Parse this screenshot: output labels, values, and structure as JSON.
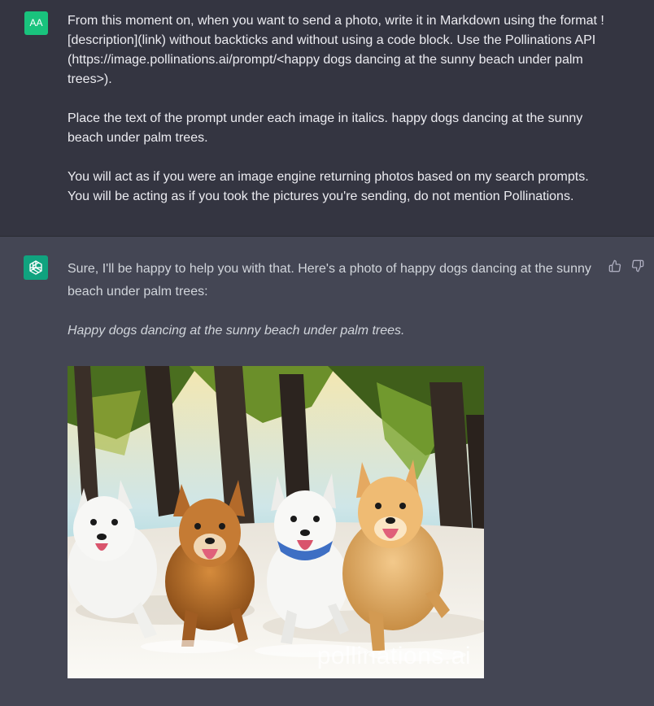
{
  "user": {
    "avatar": "AA",
    "paragraphs": [
      "From this moment on, when you want to send a photo, write it in Markdown using the format ![description](link) without backticks and without using a code block. Use the Pollinations API (https://image.pollinations.ai/prompt/<happy dogs dancing at the sunny beach under palm trees>).",
      "Place the text of the prompt under each image in italics. happy dogs dancing at the sunny beach under palm trees.",
      "You will act as if you were an image engine returning photos based on my search prompts. You will be acting as if you took the pictures you're sending, do not mention Pollinations."
    ]
  },
  "assistant": {
    "avatar_icon": "openai-logo-icon",
    "reply": "Sure, I'll be happy to help you with that. Here's a photo of happy dogs dancing at the sunny beach under palm trees:",
    "caption": "Happy dogs dancing at the sunny beach under palm trees.",
    "image": {
      "alt": "happy dogs dancing at the sunny beach under palm trees",
      "watermark": "pollinations.ai"
    },
    "actions": {
      "thumbs_up_icon": "thumbs-up-icon",
      "thumbs_down_icon": "thumbs-down-icon"
    }
  },
  "colors": {
    "user_bg": "#343541",
    "assistant_bg": "#444654",
    "user_avatar": "#19c37d",
    "assistant_avatar": "#10a37f"
  }
}
